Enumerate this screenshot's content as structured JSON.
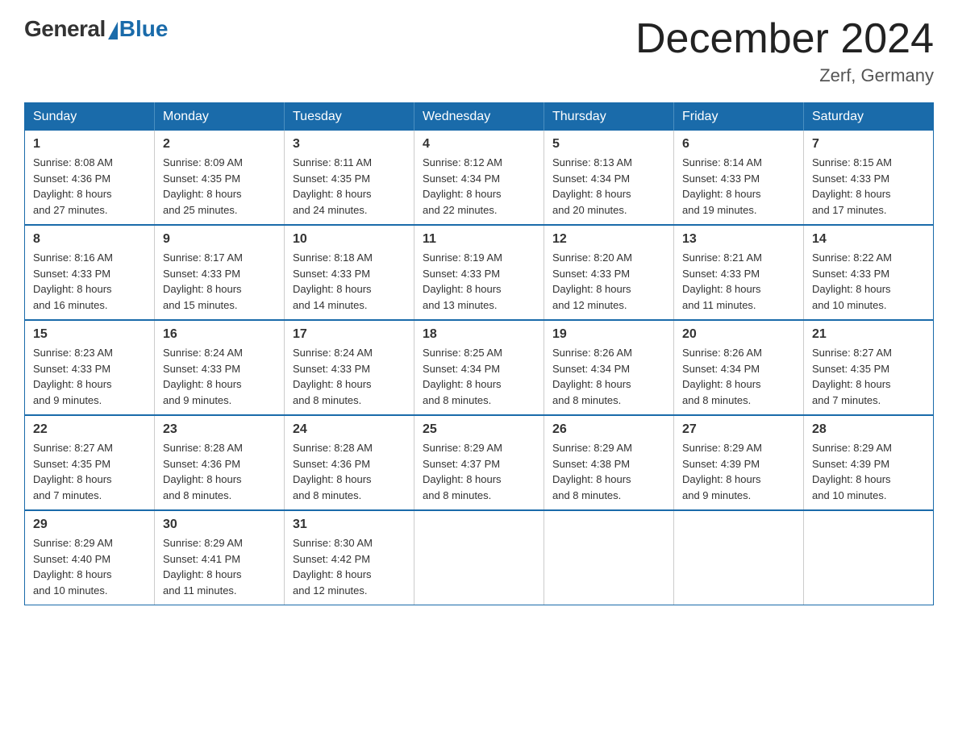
{
  "header": {
    "logo": {
      "general": "General",
      "blue": "Blue"
    },
    "title": "December 2024",
    "location": "Zerf, Germany"
  },
  "days_of_week": [
    "Sunday",
    "Monday",
    "Tuesday",
    "Wednesday",
    "Thursday",
    "Friday",
    "Saturday"
  ],
  "weeks": [
    [
      {
        "day": "1",
        "sunrise": "8:08 AM",
        "sunset": "4:36 PM",
        "daylight": "8 hours and 27 minutes."
      },
      {
        "day": "2",
        "sunrise": "8:09 AM",
        "sunset": "4:35 PM",
        "daylight": "8 hours and 25 minutes."
      },
      {
        "day": "3",
        "sunrise": "8:11 AM",
        "sunset": "4:35 PM",
        "daylight": "8 hours and 24 minutes."
      },
      {
        "day": "4",
        "sunrise": "8:12 AM",
        "sunset": "4:34 PM",
        "daylight": "8 hours and 22 minutes."
      },
      {
        "day": "5",
        "sunrise": "8:13 AM",
        "sunset": "4:34 PM",
        "daylight": "8 hours and 20 minutes."
      },
      {
        "day": "6",
        "sunrise": "8:14 AM",
        "sunset": "4:33 PM",
        "daylight": "8 hours and 19 minutes."
      },
      {
        "day": "7",
        "sunrise": "8:15 AM",
        "sunset": "4:33 PM",
        "daylight": "8 hours and 17 minutes."
      }
    ],
    [
      {
        "day": "8",
        "sunrise": "8:16 AM",
        "sunset": "4:33 PM",
        "daylight": "8 hours and 16 minutes."
      },
      {
        "day": "9",
        "sunrise": "8:17 AM",
        "sunset": "4:33 PM",
        "daylight": "8 hours and 15 minutes."
      },
      {
        "day": "10",
        "sunrise": "8:18 AM",
        "sunset": "4:33 PM",
        "daylight": "8 hours and 14 minutes."
      },
      {
        "day": "11",
        "sunrise": "8:19 AM",
        "sunset": "4:33 PM",
        "daylight": "8 hours and 13 minutes."
      },
      {
        "day": "12",
        "sunrise": "8:20 AM",
        "sunset": "4:33 PM",
        "daylight": "8 hours and 12 minutes."
      },
      {
        "day": "13",
        "sunrise": "8:21 AM",
        "sunset": "4:33 PM",
        "daylight": "8 hours and 11 minutes."
      },
      {
        "day": "14",
        "sunrise": "8:22 AM",
        "sunset": "4:33 PM",
        "daylight": "8 hours and 10 minutes."
      }
    ],
    [
      {
        "day": "15",
        "sunrise": "8:23 AM",
        "sunset": "4:33 PM",
        "daylight": "8 hours and 9 minutes."
      },
      {
        "day": "16",
        "sunrise": "8:24 AM",
        "sunset": "4:33 PM",
        "daylight": "8 hours and 9 minutes."
      },
      {
        "day": "17",
        "sunrise": "8:24 AM",
        "sunset": "4:33 PM",
        "daylight": "8 hours and 8 minutes."
      },
      {
        "day": "18",
        "sunrise": "8:25 AM",
        "sunset": "4:34 PM",
        "daylight": "8 hours and 8 minutes."
      },
      {
        "day": "19",
        "sunrise": "8:26 AM",
        "sunset": "4:34 PM",
        "daylight": "8 hours and 8 minutes."
      },
      {
        "day": "20",
        "sunrise": "8:26 AM",
        "sunset": "4:34 PM",
        "daylight": "8 hours and 8 minutes."
      },
      {
        "day": "21",
        "sunrise": "8:27 AM",
        "sunset": "4:35 PM",
        "daylight": "8 hours and 7 minutes."
      }
    ],
    [
      {
        "day": "22",
        "sunrise": "8:27 AM",
        "sunset": "4:35 PM",
        "daylight": "8 hours and 7 minutes."
      },
      {
        "day": "23",
        "sunrise": "8:28 AM",
        "sunset": "4:36 PM",
        "daylight": "8 hours and 8 minutes."
      },
      {
        "day": "24",
        "sunrise": "8:28 AM",
        "sunset": "4:36 PM",
        "daylight": "8 hours and 8 minutes."
      },
      {
        "day": "25",
        "sunrise": "8:29 AM",
        "sunset": "4:37 PM",
        "daylight": "8 hours and 8 minutes."
      },
      {
        "day": "26",
        "sunrise": "8:29 AM",
        "sunset": "4:38 PM",
        "daylight": "8 hours and 8 minutes."
      },
      {
        "day": "27",
        "sunrise": "8:29 AM",
        "sunset": "4:39 PM",
        "daylight": "8 hours and 9 minutes."
      },
      {
        "day": "28",
        "sunrise": "8:29 AM",
        "sunset": "4:39 PM",
        "daylight": "8 hours and 10 minutes."
      }
    ],
    [
      {
        "day": "29",
        "sunrise": "8:29 AM",
        "sunset": "4:40 PM",
        "daylight": "8 hours and 10 minutes."
      },
      {
        "day": "30",
        "sunrise": "8:29 AM",
        "sunset": "4:41 PM",
        "daylight": "8 hours and 11 minutes."
      },
      {
        "day": "31",
        "sunrise": "8:30 AM",
        "sunset": "4:42 PM",
        "daylight": "8 hours and 12 minutes."
      },
      null,
      null,
      null,
      null
    ]
  ],
  "labels": {
    "sunrise": "Sunrise:",
    "sunset": "Sunset:",
    "daylight": "Daylight:"
  }
}
